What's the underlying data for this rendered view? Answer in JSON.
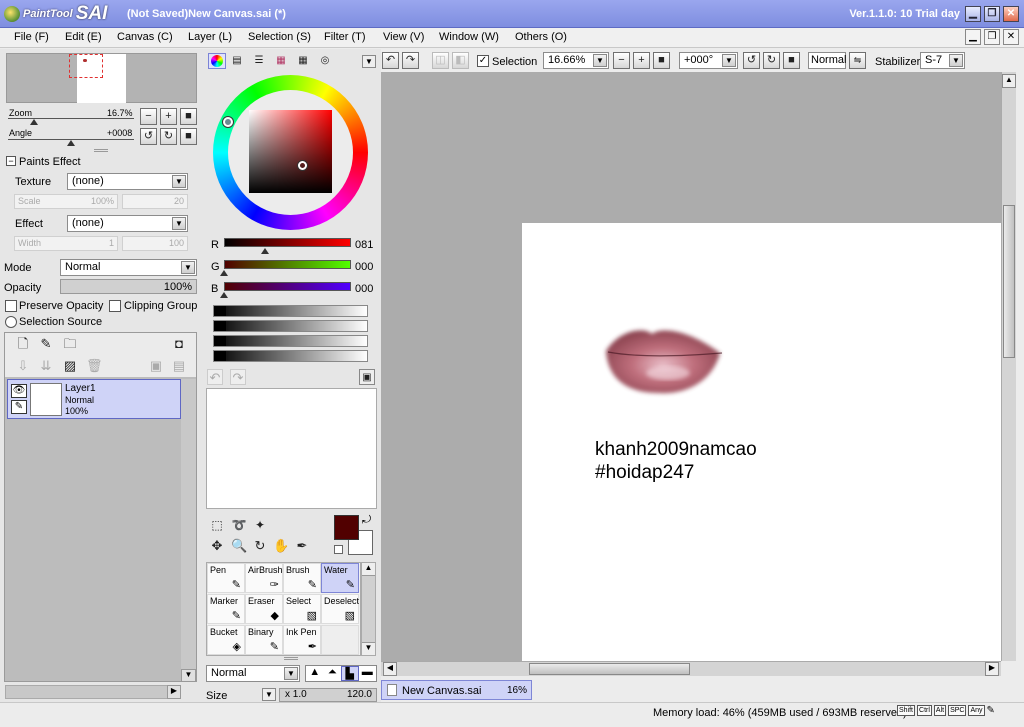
{
  "app": {
    "logo_small": "PaintTool",
    "logo_big": "SAI",
    "title": "(Not Saved)New Canvas.sai (*)",
    "version": "Ver.1.1.0: 10 Trial day"
  },
  "menu": [
    "File (F)",
    "Edit (E)",
    "Canvas (C)",
    "Layer (L)",
    "Selection (S)",
    "Filter (T)",
    "View (V)",
    "Window (W)",
    "Others (O)"
  ],
  "navigator": {
    "zoom_label": "Zoom",
    "zoom_value": "16.7%",
    "angle_label": "Angle",
    "angle_value": "+0008"
  },
  "paints_effect": {
    "header": "Paints Effect",
    "texture_label": "Texture",
    "texture_value": "(none)",
    "scale_label": "Scale",
    "scale_value": "100%",
    "scale_num": "20",
    "effect_label": "Effect",
    "effect_value": "(none)",
    "width_label": "Width",
    "width_value": "1",
    "width_num": "100"
  },
  "layer_props": {
    "mode_label": "Mode",
    "mode_value": "Normal",
    "opacity_label": "Opacity",
    "opacity_value": "100%",
    "preserve_opacity": "Preserve Opacity",
    "clipping_group": "Clipping Group",
    "selection_source": "Selection Source"
  },
  "layers": [
    {
      "name": "Layer1",
      "mode": "Normal",
      "opacity": "100%"
    }
  ],
  "color": {
    "r_label": "R",
    "g_label": "G",
    "b_label": "B",
    "r": "081",
    "g": "000",
    "b": "000",
    "r_fraction": 0.32,
    "g_fraction": 0.0,
    "b_fraction": 0.0,
    "fg": "#510000",
    "bg": "#ffffff"
  },
  "tools": [
    [
      "Pen",
      "AirBrush",
      "Brush",
      "Water"
    ],
    [
      "Marker",
      "Eraser",
      "Select",
      "Deselect"
    ],
    [
      "Bucket",
      "Binary",
      "Ink Pen",
      ""
    ]
  ],
  "selected_tool": "Water",
  "brush": {
    "mode": "Normal",
    "size_label": "Size",
    "size_mult": "x 1.0",
    "size_value": "120.0"
  },
  "canvas_toolbar": {
    "selection_label": "Selection",
    "zoom": "16.66%",
    "angle": "+000°",
    "blend": "Normal",
    "stabilizer_label": "Stabilizer",
    "stabilizer_value": "S-7"
  },
  "canvas": {
    "text_line1": "khanh2009namcao",
    "text_line2": "#hoidap247"
  },
  "tab": {
    "name": "New Canvas.sai",
    "zoom": "16%"
  },
  "status": {
    "memory": "Memory load: 46% (459MB used / 693MB reserved)",
    "keys": [
      "Shift",
      "Ctrl",
      "Alt",
      "SPC",
      "Any"
    ]
  }
}
